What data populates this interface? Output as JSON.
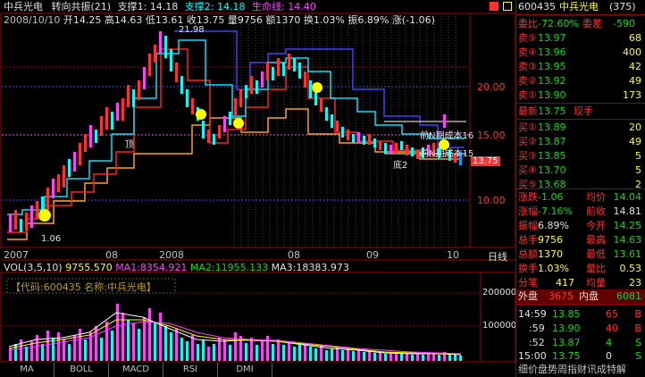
{
  "header": {
    "stock_name": "中兵光电",
    "indicator": "转向共振(21)",
    "support1_label": "支撑1",
    "support1_value": "14.18",
    "support2_label": "支撑2",
    "support2_value": "14.18",
    "lifeline_label": "生命线",
    "lifeline_value": "14.40"
  },
  "info_bar": {
    "date": "2008/10/10",
    "open": "开14.25",
    "high": "高14.63",
    "low": "低13.61",
    "close": "收13.75",
    "volume": "量9756",
    "amount": "额1370",
    "turnover": "换1.03%",
    "amplitude": "振6.89%",
    "change": "涨(-1.06)"
  },
  "price_axis": [
    "20.00",
    "15.00",
    "10.00"
  ],
  "last_price_tag": "13.75",
  "chart_notes": {
    "prev_cost": "前N期成本16",
    "prev_cost2": "前N期成本15",
    "bottom_mark": "底2",
    "top_mark": "顶",
    "low_mark": "1.06",
    "peak_label": "21.98"
  },
  "time_axis": [
    "2007",
    "08",
    "2008",
    "08",
    "09",
    "10"
  ],
  "period_label": "日线",
  "volume_header": {
    "vol": "VOL(3,5,10)",
    "vol_value": "9755.570",
    "ma1": "MA1:8354.921",
    "ma2": "MA2:11955.133",
    "ma3": "MA3:18383.973"
  },
  "volume_axis": [
    "200000",
    "100000"
  ],
  "code_box": "【代码:600435 名称:中兵光电】",
  "tabs": [
    "MA",
    "BOLL",
    "MACD",
    "RSI",
    "DMI"
  ],
  "right_panel": {
    "code": "600435",
    "name": "中兵光电",
    "number": "(375)",
    "weibi_label": "委比",
    "weibi": "-72.60%",
    "weicha_label": "委差",
    "weicha": "-590",
    "asks": [
      {
        "label": "卖⑤",
        "price": "13.97",
        "vol": "68"
      },
      {
        "label": "卖④",
        "price": "13.96",
        "vol": "400"
      },
      {
        "label": "卖③",
        "price": "13.95",
        "vol": "42"
      },
      {
        "label": "卖②",
        "price": "13.92",
        "vol": "49"
      },
      {
        "label": "卖①",
        "price": "13.90",
        "vol": "173"
      }
    ],
    "latest_label": "最新",
    "latest": "13.75",
    "now_label": "现手",
    "bids": [
      {
        "label": "买①",
        "price": "13.89",
        "vol": "20"
      },
      {
        "label": "买②",
        "price": "13.87",
        "vol": "49"
      },
      {
        "label": "买③",
        "price": "13.85",
        "vol": "5"
      },
      {
        "label": "买④",
        "price": "13.70",
        "vol": "5"
      },
      {
        "label": "买⑤",
        "price": "13.68",
        "vol": "2"
      }
    ],
    "stats": [
      {
        "l1": "涨跌",
        "v1": "-1.06",
        "l2": "均价",
        "v2": "14.04"
      },
      {
        "l1": "涨幅",
        "v1": "-7.16%",
        "l2": "前收",
        "v2": "14.81"
      },
      {
        "l1": "振幅",
        "v1": "6.89%",
        "l2": "今开",
        "v2": "14.25"
      },
      {
        "l1": "总手",
        "v1": "9756",
        "l2": "最高",
        "v2": "14.63"
      },
      {
        "l1": "总额",
        "v1": "1370",
        "l2": "最低",
        "v2": "13.61"
      },
      {
        "l1": "换手",
        "v1": "1.03%",
        "l2": "量比",
        "v2": "0.53"
      },
      {
        "l1": "分笔",
        "v1": "417",
        "l2": "均量",
        "v2": "23"
      }
    ],
    "outer_label": "外盘",
    "outer": "3675",
    "inner_label": "内盘",
    "inner": "6081",
    "ticks": [
      {
        "time": "14:59",
        "price": "13.85",
        "vol": "65",
        "side": "B"
      },
      {
        "time": ":59",
        "price": "13.90",
        "vol": "40",
        "side": "B"
      },
      {
        "time": ":52",
        "price": "13.87",
        "vol": "4",
        "side": "S"
      },
      {
        "time": "15:00",
        "price": "13.75",
        "vol": "0",
        "side": "S"
      }
    ],
    "bottom_tabs": "细价盘势周指财讯成特解"
  }
}
